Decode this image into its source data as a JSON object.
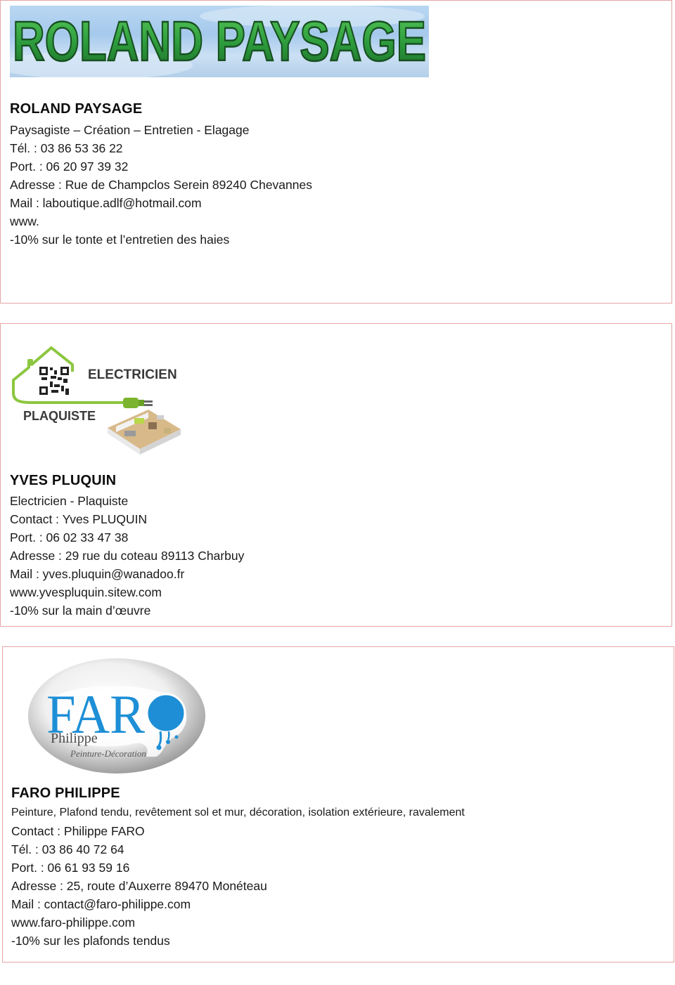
{
  "colors": {
    "card_border": "#e6a6a6",
    "logo1_text": "#2f9a3f",
    "logo2_green": "#8cc63f",
    "logo3_blue": "#1e8fd6"
  },
  "cards": [
    {
      "logo_text": "ROLAND PAYSAGE",
      "name": "ROLAND PAYSAGE",
      "lines": [
        "Paysagiste – Création – Entretien - Elagage",
        "Tél. : 03 86 53 36 22",
        "Port. : 06 20 97 39 32",
        "Adresse :  Rue de Champclos Serein 89240 Chevannes",
        "Mail : laboutique.adlf@hotmail.com",
        "www.",
        "-10% sur le tonte et l’entretien des haies"
      ]
    },
    {
      "logo_text_1": "ELECTRICIEN",
      "logo_text_2": "PLAQUISTE",
      "name": "YVES PLUQUIN",
      "lines": [
        "Electricien - Plaquiste",
        "Contact : Yves PLUQUIN",
        "Port. : 06 02 33 47 38",
        "Adresse :  29 rue du coteau 89113 Charbuy",
        "Mail : yves.pluquin@wanadoo.fr",
        "www.yvespluquin.sitew.com",
        "-10% sur la main d’œuvre"
      ]
    },
    {
      "logo_text_1": "FAR",
      "logo_text_2": "Philippe",
      "logo_text_3": "Peinture-Décoration",
      "name": "FARO PHILIPPE",
      "services": "Peinture, Plafond tendu, revêtement sol et mur, décoration, isolation extérieure, ravalement",
      "lines": [
        "Contact : Philippe FARO",
        "Tél. : 03 86 40 72 64",
        "Port. : 06 61 93 59 16",
        "Adresse :  25, route d’Auxerre 89470 Monéteau",
        "Mail : contact@faro-philippe.com",
        "www.faro-philippe.com",
        "-10% sur les plafonds tendus"
      ]
    }
  ]
}
